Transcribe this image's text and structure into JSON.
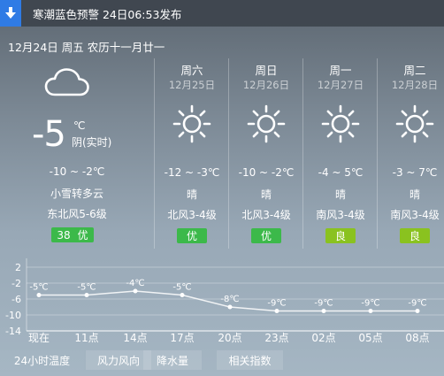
{
  "alert": {
    "icon": "down-arrow-icon",
    "text": "寒潮蓝色预警 24日06:53发布"
  },
  "date_line": "12月24日 周五 农历十一月廿一",
  "today": {
    "icon": "cloud-icon",
    "temp": "-5",
    "unit": "℃",
    "weather_now": "阴(实时)",
    "range": "-10 ~ -2℃",
    "desc": "小雪转多云",
    "wind": "东北风5-6级",
    "aqi_value": "38",
    "aqi_label": "优",
    "aqi_color": "#3cb94a"
  },
  "forecast": [
    {
      "name": "周六",
      "date": "12月25日",
      "icon": "sun-icon",
      "temp": "-12 ~ -3℃",
      "weather": "晴",
      "wind": "北风3-4级",
      "aqi": "优",
      "aqi_color": "#3cb94a"
    },
    {
      "name": "周日",
      "date": "12月26日",
      "icon": "sun-icon",
      "temp": "-10 ~ -2℃",
      "weather": "晴",
      "wind": "北风3-4级",
      "aqi": "优",
      "aqi_color": "#3cb94a"
    },
    {
      "name": "周一",
      "date": "12月27日",
      "icon": "sun-icon",
      "temp": "-4 ~ 5℃",
      "weather": "晴",
      "wind": "南风3-4级",
      "aqi": "良",
      "aqi_color": "#8ac21f"
    },
    {
      "name": "周二",
      "date": "12月28日",
      "icon": "sun-icon",
      "temp": "-3 ~ 7℃",
      "weather": "晴",
      "wind": "南风3-4级",
      "aqi": "良",
      "aqi_color": "#8ac21f"
    }
  ],
  "chart_data": {
    "type": "line",
    "categories": [
      "现在",
      "11点",
      "14点",
      "17点",
      "20点",
      "23点",
      "02点",
      "05点",
      "08点"
    ],
    "values": [
      -5,
      -5,
      -4,
      -5,
      -8,
      -9,
      -9,
      -9,
      -9
    ],
    "point_labels": [
      "-5℃",
      "-5℃",
      "-4℃",
      "-5℃",
      "-8℃",
      "-9℃",
      "-9℃",
      "-9℃",
      "-9℃"
    ],
    "yticks": [
      "2",
      "-2",
      "-6",
      "-10",
      "-14"
    ],
    "ylim": [
      -14,
      2
    ],
    "grid": true,
    "xlabel": "",
    "ylabel": ""
  },
  "tabs": [
    {
      "label": "24小时温度"
    },
    {
      "label": "风力风向"
    },
    {
      "label": "降水量"
    },
    {
      "label": "相关指数"
    }
  ]
}
